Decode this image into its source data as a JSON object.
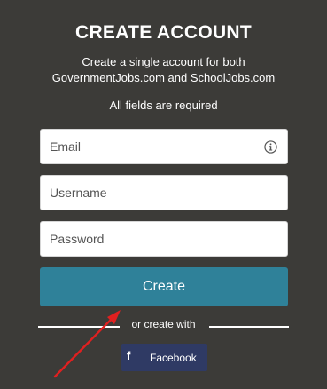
{
  "header": {
    "title": "CREATE ACCOUNT",
    "subtitle_line1": "Create a single account for both",
    "link_government": "GovernmentJobs.com",
    "subtitle_and": " and SchoolJobs.com",
    "required_note": "All fields are required"
  },
  "form": {
    "email_placeholder": "Email",
    "username_placeholder": "Username",
    "password_placeholder": "Password",
    "create_label": "Create"
  },
  "alternate": {
    "divider_text": "or create with",
    "facebook_label": "Facebook",
    "facebook_icon": "f"
  },
  "colors": {
    "background": "#3c3b38",
    "primary_button": "#2f8199",
    "facebook_button": "#2f3a64",
    "annotation_arrow": "#e02020"
  }
}
